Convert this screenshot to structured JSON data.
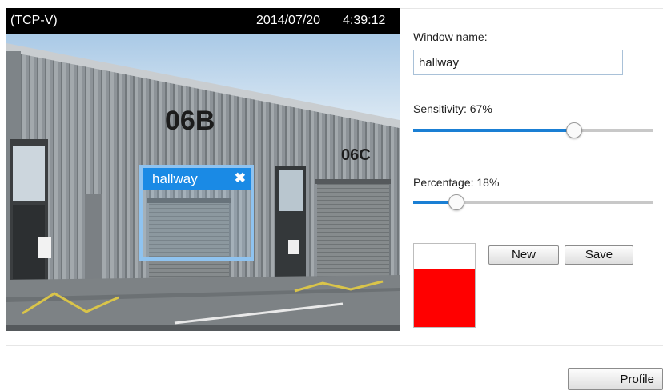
{
  "viewer": {
    "stream_label": "(TCP-V)",
    "date": "2014/07/20",
    "time": "4:39:12",
    "scene_text": {
      "unit_left": "06B",
      "unit_right": "06C"
    }
  },
  "motion_window": {
    "name": "hallway",
    "close_icon": "close-x-icon"
  },
  "form": {
    "window_name_label": "Window name:",
    "window_name_value": "hallway",
    "sensitivity_label": "Sensitivity: 67%",
    "sensitivity_value": 0.67,
    "percentage_label": "Percentage: 18%",
    "percentage_value": 0.18,
    "activity_level": 0.7,
    "activity_color": "#ff0000",
    "new_label": "New",
    "save_label": "Save"
  },
  "footer": {
    "profile_label": "Profile"
  },
  "colors": {
    "accent": "#1a7fd4",
    "window_header": "#1a8ae5",
    "window_border": "#8fc3f0"
  }
}
